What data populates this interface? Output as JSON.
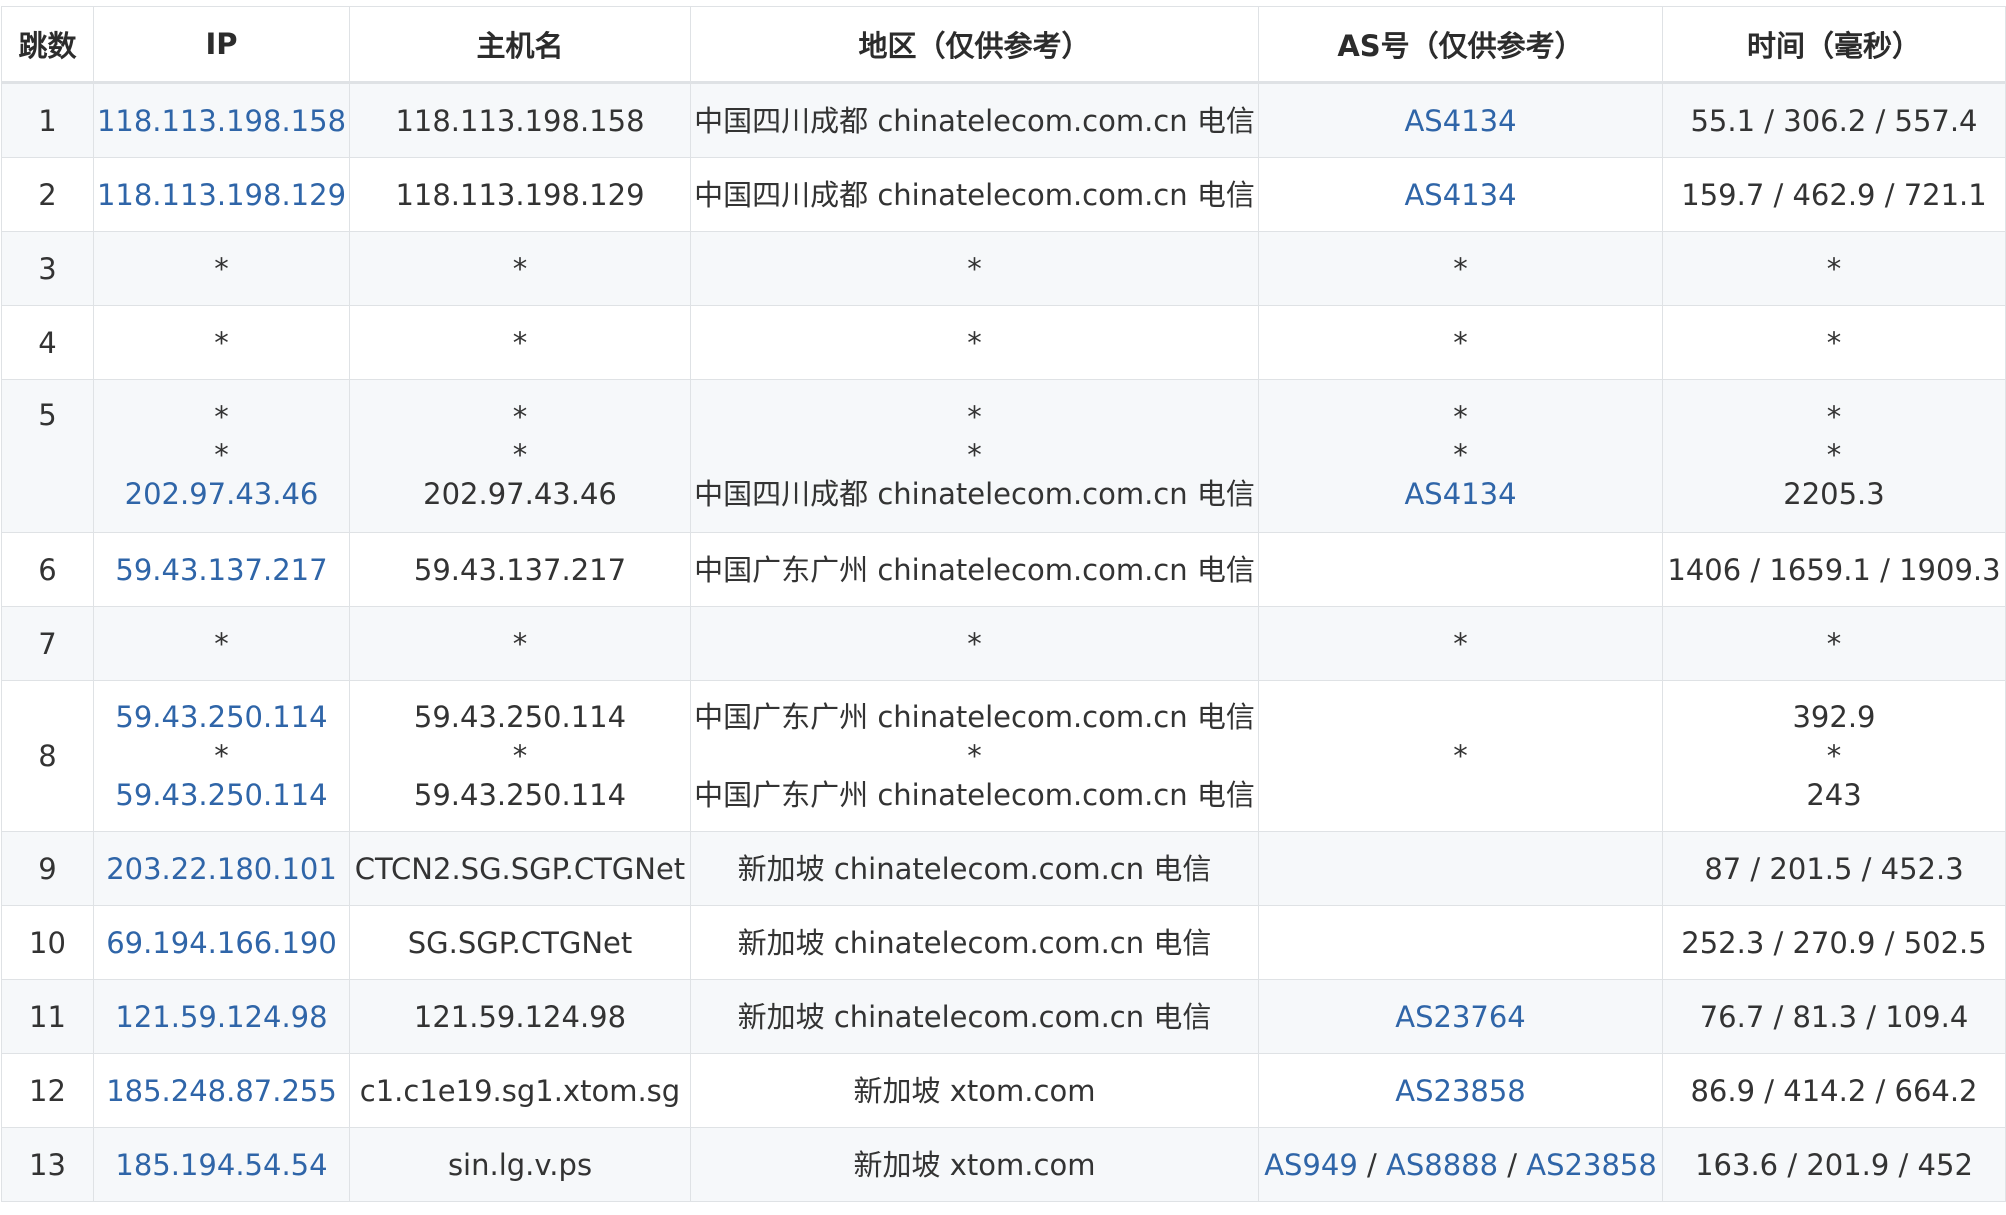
{
  "headers": [
    "跳数",
    "IP",
    "主机名",
    "地区（仅供参考）",
    "AS号（仅供参考）",
    "时间（毫秒）"
  ],
  "rows": [
    {
      "hop": "1",
      "ip": [
        "118.113.198.158"
      ],
      "host": [
        "118.113.198.158"
      ],
      "region": [
        "中国四川成都 chinatelecom.com.cn 电信"
      ],
      "as": [
        "AS4134"
      ],
      "time": [
        "55.1 / 306.2 / 557.4"
      ]
    },
    {
      "hop": "2",
      "ip": [
        "118.113.198.129"
      ],
      "host": [
        "118.113.198.129"
      ],
      "region": [
        "中国四川成都 chinatelecom.com.cn 电信"
      ],
      "as": [
        "AS4134"
      ],
      "time": [
        "159.7 / 462.9 / 721.1"
      ]
    },
    {
      "hop": "3",
      "ip": [
        "*"
      ],
      "host": [
        "*"
      ],
      "region": [
        "*"
      ],
      "as": [
        "*"
      ],
      "time": [
        "*"
      ]
    },
    {
      "hop": "4",
      "ip": [
        "*"
      ],
      "host": [
        "*"
      ],
      "region": [
        "*"
      ],
      "as": [
        "*"
      ],
      "time": [
        "*"
      ]
    },
    {
      "hop": "5",
      "ip": [
        "*",
        "*",
        "202.97.43.46"
      ],
      "host": [
        "*",
        "*",
        "202.97.43.46"
      ],
      "region": [
        "*",
        "*",
        "中国四川成都 chinatelecom.com.cn 电信"
      ],
      "as": [
        "*",
        "*",
        "AS4134"
      ],
      "time": [
        "*",
        "*",
        "2205.3"
      ]
    },
    {
      "hop": "6",
      "ip": [
        "59.43.137.217"
      ],
      "host": [
        "59.43.137.217"
      ],
      "region": [
        "中国广东广州 chinatelecom.com.cn 电信"
      ],
      "as": [
        ""
      ],
      "time": [
        "1406 / 1659.1 / 1909.3"
      ]
    },
    {
      "hop": "7",
      "ip": [
        "*"
      ],
      "host": [
        "*"
      ],
      "region": [
        "*"
      ],
      "as": [
        "*"
      ],
      "time": [
        "*"
      ]
    },
    {
      "hop": "8",
      "ip": [
        "59.43.250.114",
        "*",
        "59.43.250.114"
      ],
      "host": [
        "59.43.250.114",
        "*",
        "59.43.250.114"
      ],
      "region": [
        "中国广东广州 chinatelecom.com.cn 电信",
        "*",
        "中国广东广州 chinatelecom.com.cn 电信"
      ],
      "as": [
        "*"
      ],
      "time": [
        "392.9",
        "*",
        "243"
      ]
    },
    {
      "hop": "9",
      "ip": [
        "203.22.180.101"
      ],
      "host": [
        "CTCN2.SG.SGP.CTGNet"
      ],
      "region": [
        "新加坡 chinatelecom.com.cn 电信"
      ],
      "as": [
        ""
      ],
      "time": [
        "87 / 201.5 / 452.3"
      ]
    },
    {
      "hop": "10",
      "ip": [
        "69.194.166.190"
      ],
      "host": [
        "SG.SGP.CTGNet"
      ],
      "region": [
        "新加坡 chinatelecom.com.cn 电信"
      ],
      "as": [
        ""
      ],
      "time": [
        "252.3 / 270.9 / 502.5"
      ]
    },
    {
      "hop": "11",
      "ip": [
        "121.59.124.98"
      ],
      "host": [
        "121.59.124.98"
      ],
      "region": [
        "新加坡 chinatelecom.com.cn 电信"
      ],
      "as": [
        "AS23764"
      ],
      "time": [
        "76.7 / 81.3 / 109.4"
      ]
    },
    {
      "hop": "12",
      "ip": [
        "185.248.87.255"
      ],
      "host": [
        "c1.c1e19.sg1.xtom.sg"
      ],
      "region": [
        "新加坡 xtom.com"
      ],
      "as": [
        "AS23858"
      ],
      "time": [
        "86.9 / 414.2 / 664.2"
      ]
    },
    {
      "hop": "13",
      "ip": [
        "185.194.54.54"
      ],
      "host": [
        "sin.lg.v.ps"
      ],
      "region": [
        "新加坡 xtom.com"
      ],
      "as": [
        "AS949 / AS8888 / AS23858"
      ],
      "time": [
        "163.6 / 201.9 / 452"
      ]
    }
  ],
  "colors": {
    "link": "#2f65a8",
    "text": "#333333",
    "border": "#dfe2e5",
    "stripe": "#f6f8fa"
  }
}
